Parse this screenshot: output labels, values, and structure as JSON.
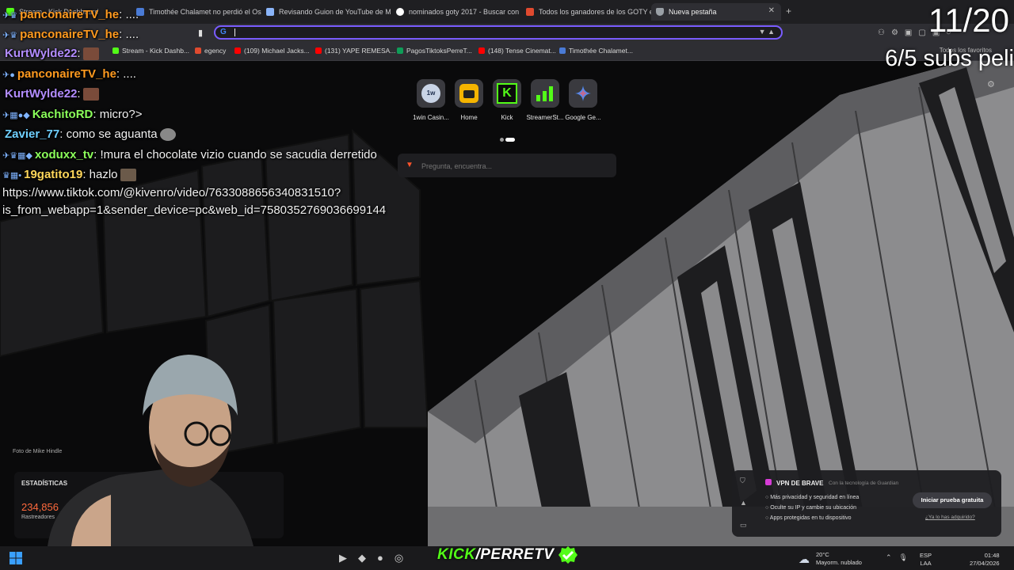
{
  "browser": {
    "tabs": [
      {
        "title": "Stream - Kick Dashboard",
        "color": "#53fc18"
      },
      {
        "title": "Timothée Chalamet no perdió el Osc",
        "color": "#4a7bd6"
      },
      {
        "title": "Revisando Guion de YouTube de Mar",
        "color": "#8ab4f8"
      },
      {
        "title": "nominados goty 2017 - Buscar con G",
        "color": "#ffffff"
      },
      {
        "title": "Todos los ganadores de los GOTY en",
        "color": "#e04a2f"
      },
      {
        "title": "Nueva pestaña",
        "color": "#9aa0a6"
      }
    ],
    "new_tab_symbol": "+",
    "close_symbol": "✕",
    "omnibox_value": "",
    "bookmarks": [
      {
        "label": "Stream - Kick Dashb...",
        "color": "#53fc18"
      },
      {
        "label": "egency",
        "color": "#e04a2f"
      },
      {
        "label": "(109) Michael Jacks...",
        "color": "#ff0000"
      },
      {
        "label": "(131) YAPE REMESA...",
        "color": "#ff0000"
      },
      {
        "label": "PagosTiktoksPerreT...",
        "color": "#0f9d58"
      },
      {
        "label": "(148) Tense Cinemat...",
        "color": "#ff0000"
      },
      {
        "label": "Timothée Chalamet...",
        "color": "#4a7bd6"
      }
    ],
    "bookmarks_right": "Todos los favoritos"
  },
  "new_tab": {
    "shortcuts": [
      {
        "label": "1win Casin...",
        "icon": "1w",
        "bg": "#c9d4e6",
        "fg": "#1a2a4a"
      },
      {
        "label": "Home",
        "icon": "clapper-icon",
        "bg": "#f5b400",
        "fg": "#222"
      },
      {
        "label": "Kick",
        "icon": "K",
        "bg": "#53fc18",
        "fg": "#000"
      },
      {
        "label": "StreamerSt...",
        "icon": "bars-icon",
        "bg": "#3a3a3f",
        "fg": "#53fc18"
      },
      {
        "label": "Google Ge...",
        "icon": "gemini-icon",
        "bg": "#3a3a3f",
        "fg": "#4d8cf5"
      }
    ],
    "search_placeholder": "Pregunta, encuentra...",
    "photo_credit": "Foto de Mike Hindle",
    "stats": {
      "title": "ESTADÍSTICAS",
      "value": "234,856",
      "subtitle": "Rastreadores"
    },
    "vpn": {
      "title": "VPN DE BRAVE",
      "tech": "Con la tecnología de Guardian",
      "features": [
        "Más privacidad y seguridad en línea",
        "Oculte su IP y cambie su ubicación",
        "Apps protegidas en tu dispositivo"
      ],
      "cta": "Iniciar prueba gratuita",
      "link": "¿Ya lo has adquirido?"
    }
  },
  "overlay": {
    "counter": "11/20",
    "subs": "6/5 subs peli",
    "chat": [
      {
        "badges": "✈♛",
        "user": "panconaireTV_he",
        "user_color": "#ff9a1f",
        "text": ": ...."
      },
      {
        "badges": "✈♛",
        "user": "panconaireTV_he",
        "user_color": "#ff9a1f",
        "text": ": ...."
      },
      {
        "badges": "",
        "user": "KurtWylde22",
        "user_color": "#b28cff",
        "text": ":"
      },
      {
        "badges": "✈●",
        "user": "panconaireTV_he",
        "user_color": "#ff9a1f",
        "text": ": ...."
      },
      {
        "badges": "",
        "user": "KurtWylde22",
        "user_color": "#b28cff",
        "text": ":"
      },
      {
        "badges": "✈▦●◆",
        "user": "KachitoRD",
        "user_color": "#8bff5a",
        "text": ": micro?>"
      },
      {
        "badges": "",
        "user": "Zavier_77",
        "user_color": "#6fd0ff",
        "text": ": como se aguanta"
      },
      {
        "badges": "✈♛▦◆",
        "user": "xoduxx_tv",
        "user_color": "#8bff5a",
        "text": ": !mura el chocolate vizio cuando se sacudia derretido"
      },
      {
        "badges": "♛▦•",
        "user": "19gatito19",
        "user_color": "#ffd75a",
        "text": ": hazlo"
      }
    ],
    "link_line1": "https://www.tiktok.com/@kivenro/video/7633088656340831510?",
    "link_line2": "is_from_webapp=1&sender_device=pc&web_id=7580352769036699144",
    "brand_prefix": "KICK",
    "brand_suffix": "/PERRETV"
  },
  "taskbar": {
    "weather_temp": "20°C",
    "weather_text": "Mayorm. nublado",
    "lang_top": "ESP",
    "lang_bottom": "LAA",
    "time": "01:48",
    "date": "27/04/2026"
  }
}
